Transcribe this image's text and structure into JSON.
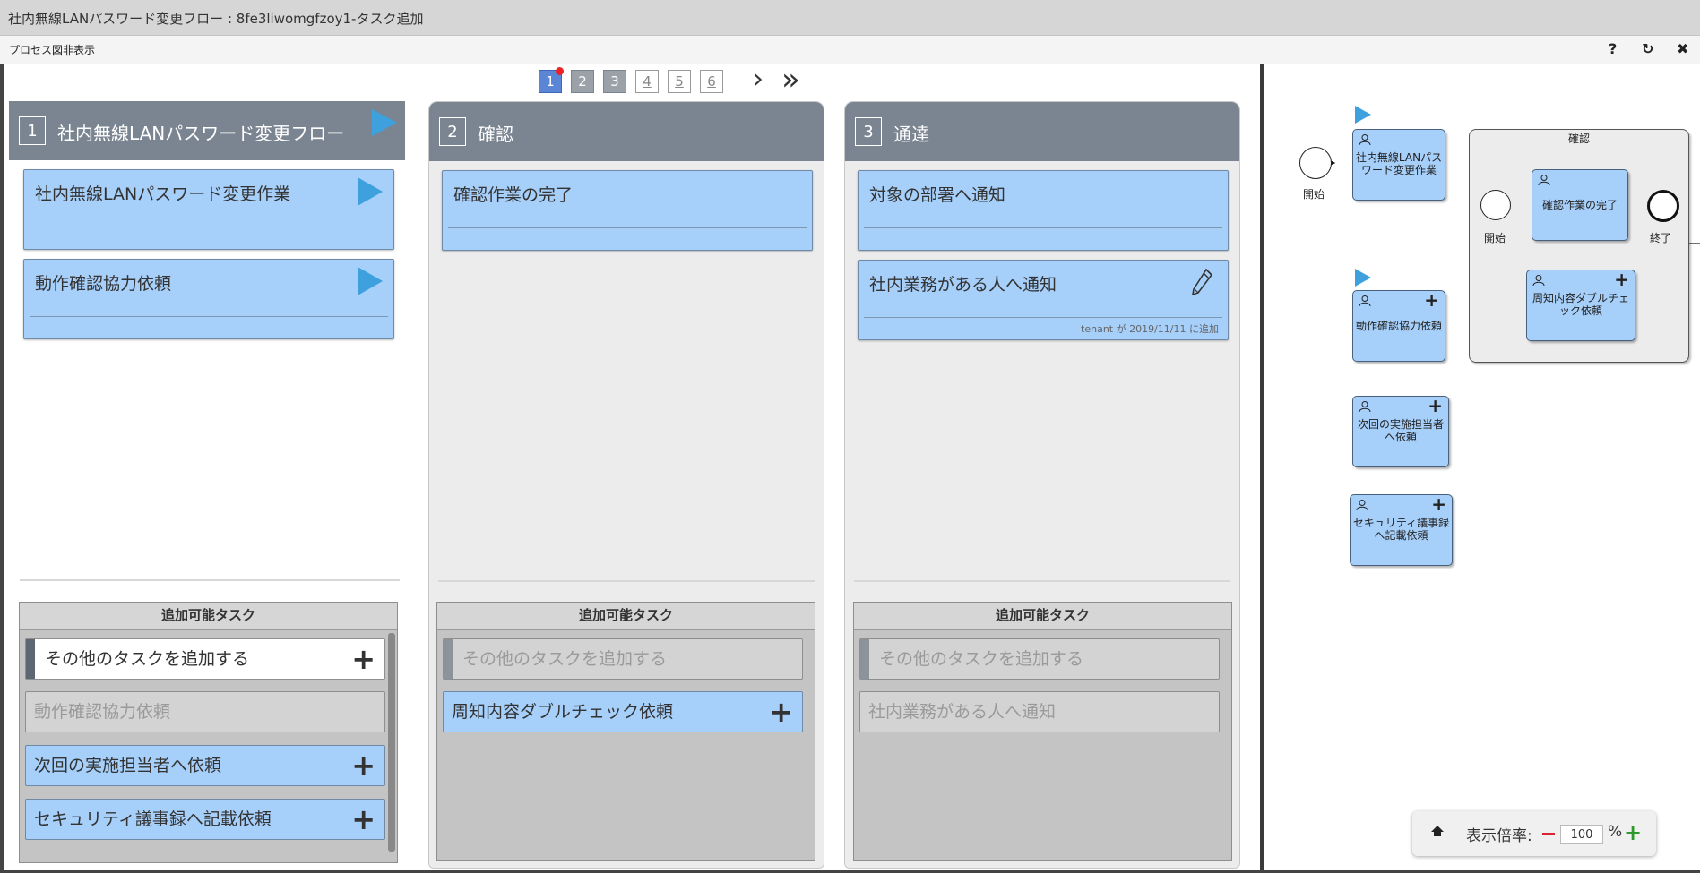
{
  "window": {
    "title": "社内無線LANパスワード変更フロー : 8fe3liwomgfzoy1-タスク追加"
  },
  "toolbar": {
    "toggle_label": "プロセス図非表示",
    "help": "?",
    "refresh": "↻",
    "close": "✖"
  },
  "pager": {
    "pages": [
      "1",
      "2",
      "3",
      "4",
      "5",
      "6"
    ],
    "next": "›",
    "last": "»"
  },
  "lanes": [
    {
      "number": "1",
      "title": "社内無線LANパスワード変更フロー",
      "tasks": [
        {
          "name": "社内無線LANパスワード変更作業"
        },
        {
          "name": "動作確認協力依頼"
        }
      ],
      "add_header": "追加可能タスク",
      "add_items": [
        {
          "label": "その他のタスクを追加する"
        },
        {
          "label": "動作確認協力依頼"
        },
        {
          "label": "次回の実施担当者へ依頼"
        },
        {
          "label": "セキュリティ議事録へ記載依頼"
        }
      ]
    },
    {
      "number": "2",
      "title": "確認",
      "tasks": [
        {
          "name": "確認作業の完了"
        }
      ],
      "add_header": "追加可能タスク",
      "add_items": [
        {
          "label": "その他のタスクを追加する"
        },
        {
          "label": "周知内容ダブルチェック依頼"
        }
      ]
    },
    {
      "number": "3",
      "title": "通達",
      "tasks": [
        {
          "name": "対象の部署へ通知"
        },
        {
          "name": "社内業務がある人へ通知",
          "meta": "tenant が 2019/11/11 に追加"
        }
      ],
      "add_header": "追加可能タスク",
      "add_items": [
        {
          "label": "その他のタスクを追加する"
        },
        {
          "label": "社内業務がある人へ通知"
        }
      ]
    }
  ],
  "diagram": {
    "start_label": "開始",
    "task1": "社内無線LANパスワード変更作業",
    "task1_lines": [
      "社内無線LANパス",
      "ワード変更作業"
    ],
    "task2": "動作確認協力依頼",
    "task3_lines": [
      "次回の実施担当者",
      "へ依頼"
    ],
    "task4_lines": [
      "セキュリティ議事録",
      "へ記載依頼"
    ],
    "sub_title": "確認",
    "sub_start": "開始",
    "sub_task": "確認作業の完了",
    "sub_end": "終了",
    "sub_extra_lines": [
      "周知内容ダブルチェ",
      "ック依頼"
    ]
  },
  "zoom": {
    "label": "表示倍率:",
    "value": "100",
    "unit": "%"
  },
  "colors": {
    "task_blue": "#a6cffa",
    "lane_header": "#7b8591",
    "play_blue": "#3ea0dc",
    "zoom_minus": "#dd2233",
    "zoom_plus": "#2b9a2b"
  }
}
